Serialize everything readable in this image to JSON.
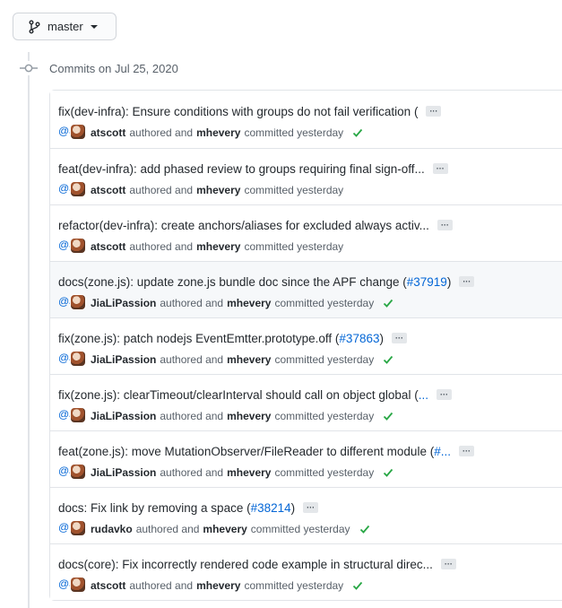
{
  "branch": {
    "label": "master",
    "icon": "git-branch-icon"
  },
  "commits_header": {
    "label": "Commits on Jul 25, 2020",
    "icon": "git-commit-icon"
  },
  "commits": [
    {
      "message": "fix(dev-infra): Ensure conditions with groups do not fail verification (",
      "pr": "",
      "tail": "",
      "avatar_text": "@a",
      "author": "atscott",
      "authored_text": "authored and",
      "committer": "mhevery",
      "committed_text": "committed yesterday",
      "check": true,
      "highlighted": false
    },
    {
      "message": "feat(dev-infra): add phased review to groups requiring final sign-off...",
      "pr": "",
      "tail": "",
      "avatar_text": "@a",
      "author": "atscott",
      "authored_text": "authored and",
      "committer": "mhevery",
      "committed_text": "committed yesterday",
      "check": false,
      "highlighted": false
    },
    {
      "message": "refactor(dev-infra): create anchors/aliases for excluded always activ...",
      "pr": "",
      "tail": "",
      "avatar_text": "@a",
      "author": "atscott",
      "authored_text": "authored and",
      "committer": "mhevery",
      "committed_text": "committed yesterday",
      "check": false,
      "highlighted": false
    },
    {
      "message": "docs(zone.js): update zone.js bundle doc since the APF change (",
      "pr": "#37919",
      "tail": ")",
      "avatar_text": "@J",
      "author": "JiaLiPassion",
      "authored_text": "authored and",
      "committer": "mhevery",
      "committed_text": "committed yesterday",
      "check": true,
      "highlighted": true
    },
    {
      "message": "fix(zone.js): patch nodejs EventEmtter.prototype.off (",
      "pr": "#37863",
      "tail": ")",
      "avatar_text": "@J",
      "author": "JiaLiPassion",
      "authored_text": "authored and",
      "committer": "mhevery",
      "committed_text": "committed yesterday",
      "check": true,
      "highlighted": false
    },
    {
      "message": "fix(zone.js): clearTimeout/clearInterval should call on object global (",
      "pr": "...",
      "tail": "",
      "avatar_text": "@J",
      "author": "JiaLiPassion",
      "authored_text": "authored and",
      "committer": "mhevery",
      "committed_text": "committed yesterday",
      "check": true,
      "highlighted": false
    },
    {
      "message": "feat(zone.js): move MutationObserver/FileReader to different module (",
      "pr": "#...",
      "tail": "",
      "avatar_text": "@J",
      "author": "JiaLiPassion",
      "authored_text": "authored and",
      "committer": "mhevery",
      "committed_text": "committed yesterday",
      "check": true,
      "highlighted": false
    },
    {
      "message": "docs: Fix link by removing a space (",
      "pr": "#38214",
      "tail": ")",
      "avatar_text": "@r",
      "author": "rudavko",
      "authored_text": "authored and",
      "committer": "mhevery",
      "committed_text": "committed yesterday",
      "check": true,
      "highlighted": false
    },
    {
      "message": "docs(core): Fix incorrectly rendered code example in structural direc...",
      "pr": "",
      "tail": "",
      "avatar_text": "@a",
      "author": "atscott",
      "authored_text": "authored and",
      "committer": "mhevery",
      "committed_text": "committed yesterday",
      "check": true,
      "highlighted": false
    }
  ],
  "ellipsis_label": "···",
  "colors": {
    "link": "#0366d6",
    "success": "#28a745",
    "border": "#e1e4e8",
    "highlight_bg": "#f6f8fa"
  }
}
